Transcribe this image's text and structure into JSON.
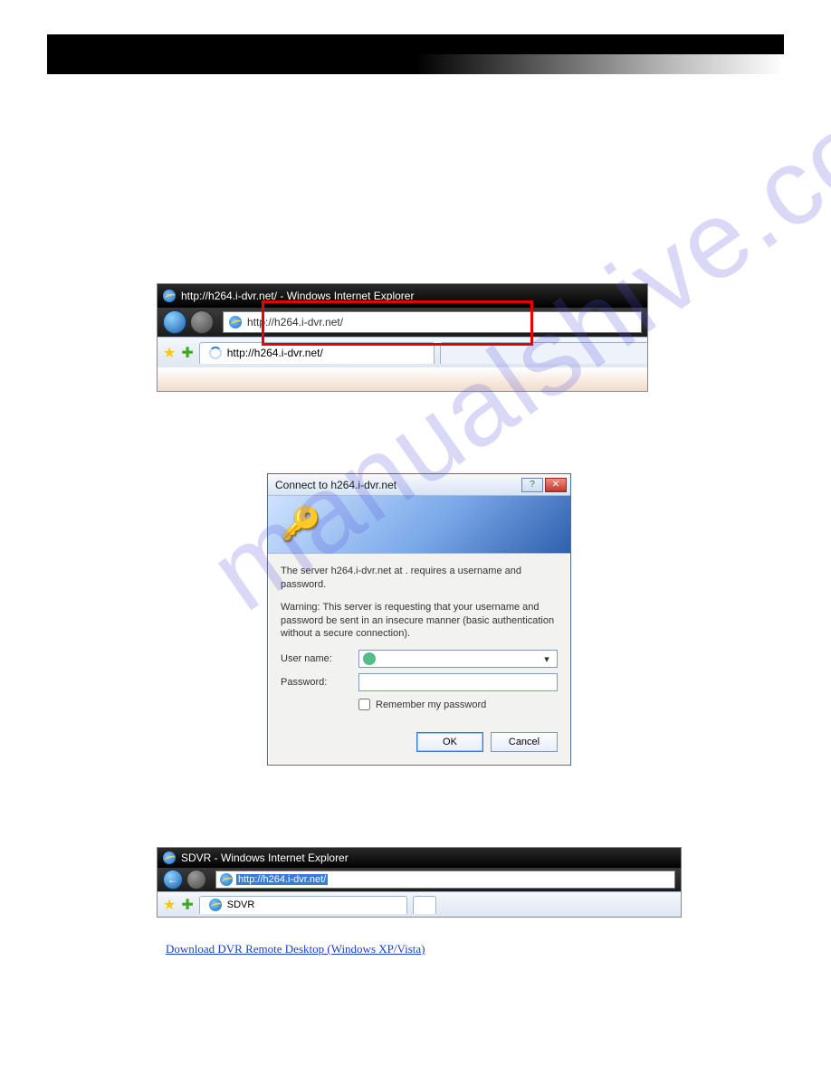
{
  "ie1": {
    "window_title": "http://h264.i-dvr.net/ - Windows Internet Explorer",
    "url": "http://h264.i-dvr.net/",
    "tab_label": "http://h264.i-dvr.net/"
  },
  "dialog": {
    "title": "Connect to h264.i-dvr.net",
    "msg1": "The server h264.i-dvr.net at . requires a username and password.",
    "msg2": "Warning: This server is requesting that your username and password be sent in an insecure manner (basic authentication without a secure connection).",
    "username_label": "User name:",
    "password_label": "Password:",
    "remember_label": "Remember my password",
    "ok": "OK",
    "cancel": "Cancel",
    "help_symbol": "?",
    "close_symbol": "✕"
  },
  "ie2": {
    "window_title": "SDVR - Windows Internet Explorer",
    "url": "http://h264.i-dvr.net/",
    "tab_label": "SDVR"
  },
  "link": {
    "text": "Download DVR Remote Desktop (Windows XP/Vista)"
  },
  "watermark": "manualshive.com"
}
